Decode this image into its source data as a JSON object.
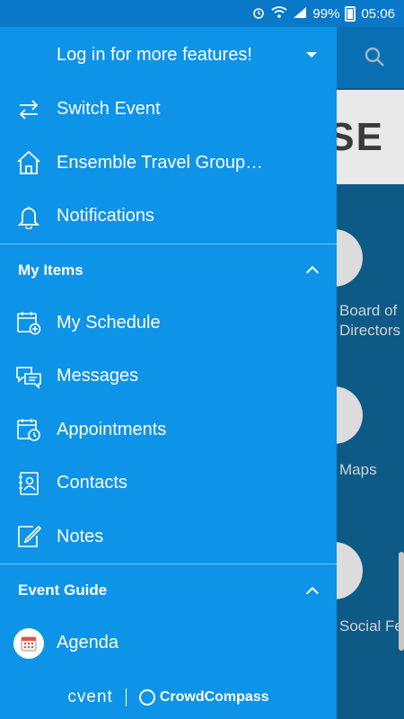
{
  "status_bar": {
    "battery": "99%",
    "time": "05:06"
  },
  "background": {
    "banner_text": "PURPOSE",
    "tiles": [
      {
        "label": "Board of Directors"
      },
      {
        "label": "Maps"
      },
      {
        "label": "Social Feed"
      }
    ]
  },
  "drawer": {
    "header_label": "Log in for more features!",
    "top_items": [
      {
        "label": "Switch Event",
        "icon": "swap-arrows-icon"
      },
      {
        "label": "Ensemble Travel Group…",
        "icon": "home-icon"
      },
      {
        "label": "Notifications",
        "icon": "bell-icon"
      }
    ],
    "sections": [
      {
        "title": "My Items",
        "items": [
          {
            "label": "My Schedule",
            "icon": "schedule-calendar-icon"
          },
          {
            "label": "Messages",
            "icon": "chat-bubbles-icon"
          },
          {
            "label": "Appointments",
            "icon": "calendar-clock-icon"
          },
          {
            "label": "Contacts",
            "icon": "contacts-book-icon"
          },
          {
            "label": "Notes",
            "icon": "notes-pencil-icon"
          }
        ]
      },
      {
        "title": "Event Guide",
        "items": [
          {
            "label": "Agenda",
            "icon": "agenda-calendar-icon"
          }
        ]
      }
    ],
    "footer": {
      "brand": "cvent",
      "partner": "CrowdCompass"
    }
  },
  "colors": {
    "drawer_bg": "#0d93e7",
    "status_bar_bg": "#0a78c8",
    "agenda_icon_accent": "#e8503a"
  }
}
